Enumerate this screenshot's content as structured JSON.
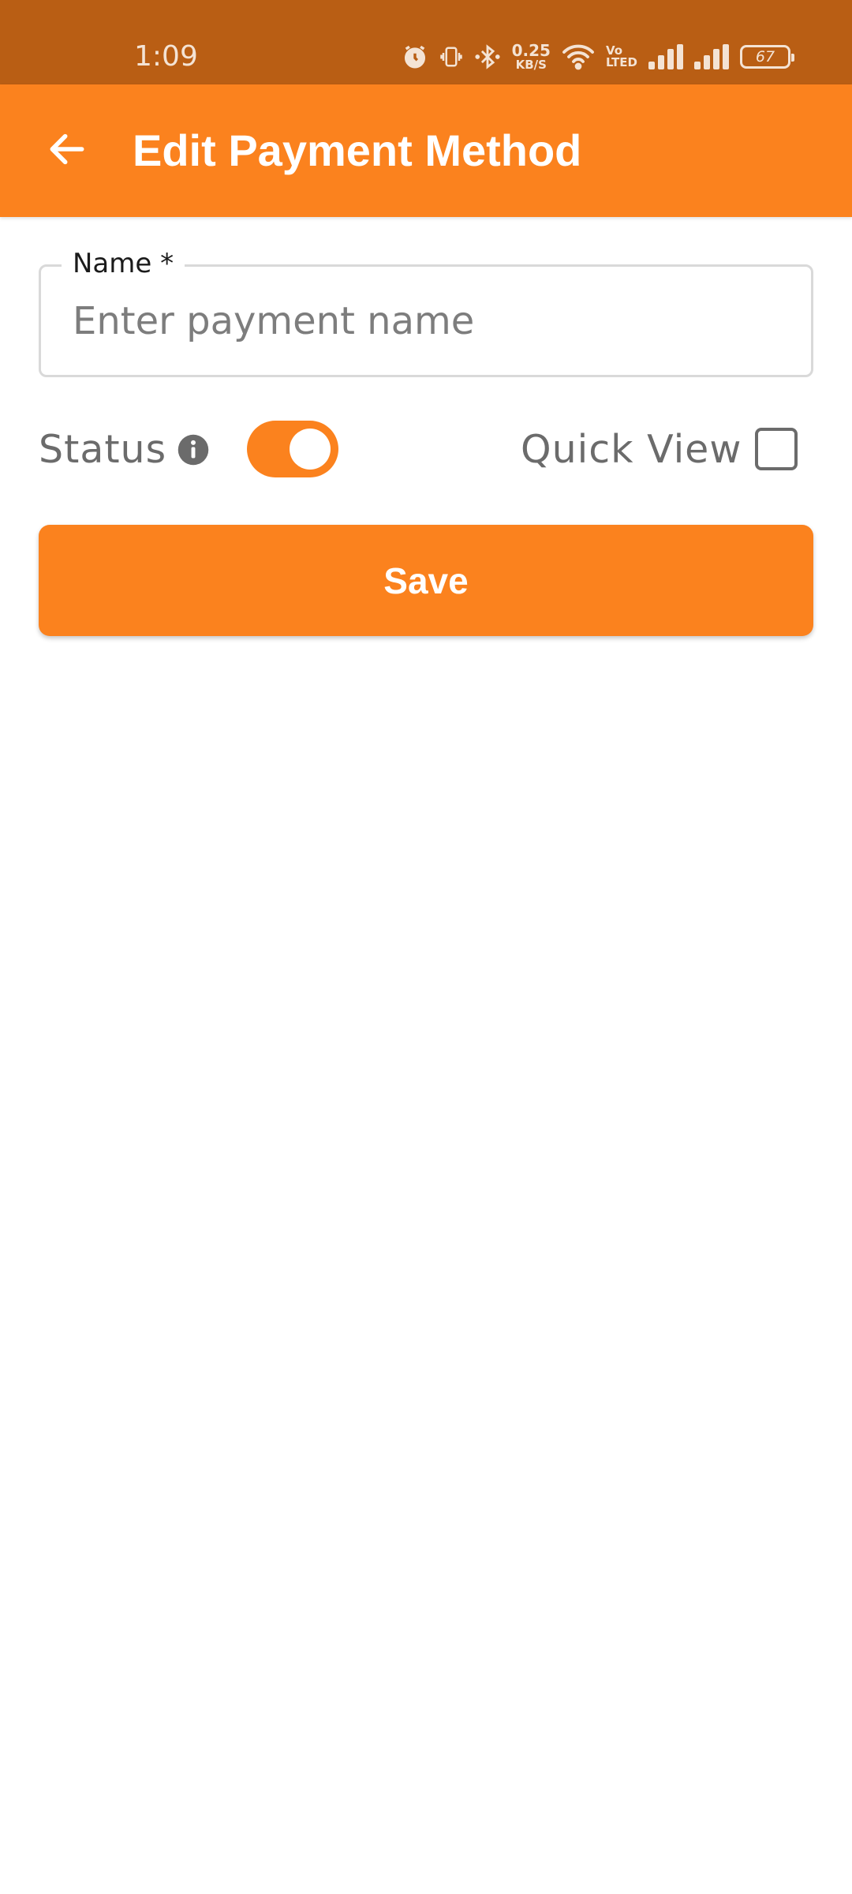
{
  "status_bar": {
    "time": "1:09",
    "net_speed_value": "0.25",
    "net_speed_unit": "KB/S",
    "volte_top": "Vo",
    "volte_bottom": "LTED",
    "battery": "67",
    "icons": [
      "alarm-icon",
      "vibrate-icon",
      "bluetooth-icon",
      "wifi-icon",
      "signal-icon",
      "signal-icon",
      "battery-icon"
    ]
  },
  "app_bar": {
    "title": "Edit Payment Method",
    "back_icon": "arrow-left-icon"
  },
  "form": {
    "name_label": "Name *",
    "name_placeholder": "Enter payment name",
    "name_value": "",
    "status_label": "Status",
    "status_on": true,
    "quick_view_label": "Quick View",
    "quick_view_checked": false,
    "save_label": "Save"
  },
  "colors": {
    "status_bar": "#B95E14",
    "accent": "#FB821E",
    "text_muted": "#6B6B6B"
  }
}
